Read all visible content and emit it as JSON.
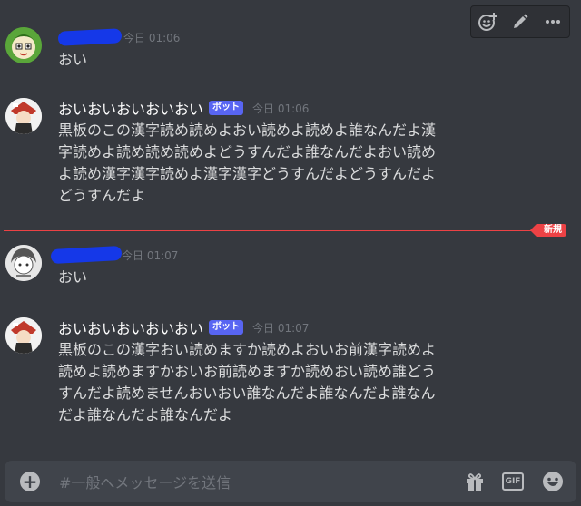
{
  "new_label": "新規",
  "bot_label": "ボット",
  "messages": [
    {
      "author": "",
      "timestamp": "今日 01:06",
      "content": "おい"
    },
    {
      "author": "おいおいおいおいおい",
      "timestamp": "今日 01:06",
      "content": "黒板のこの漢字読め読めよおい読めよ読めよ誰なんだよ漢\n字読めよ読め読め読めよどうすんだよ誰なんだよおい読め\nよ読め漢字漢字読めよ漢字漢字どうすんだよどうすんだよ\nどうすんだよ"
    },
    {
      "author": "",
      "timestamp": "今日 01:07",
      "content": "おい"
    },
    {
      "author": "おいおいおいおいおい",
      "timestamp": "今日 01:07",
      "content": "黒板のこの漢字おい読めますか読めよおいお前漢字読めよ\n読めよ読めますかおいお前読めますか読めおい読め誰どう\nすんだよ読めませんおいおい誰なんだよ誰なんだよ誰なん\nだよ誰なんだよ誰なんだよ"
    }
  ],
  "composer": {
    "placeholder": "#一般へメッセージを送信"
  },
  "icons": {
    "toolbar": [
      "add-reaction-icon",
      "edit-icon",
      "more-icon"
    ],
    "composer": [
      "plus-icon",
      "gift-icon",
      "gif-icon",
      "emoji-icon"
    ]
  },
  "colors": {
    "accent": "#5865f2",
    "new": "#ed4245",
    "background": "#36393f"
  }
}
